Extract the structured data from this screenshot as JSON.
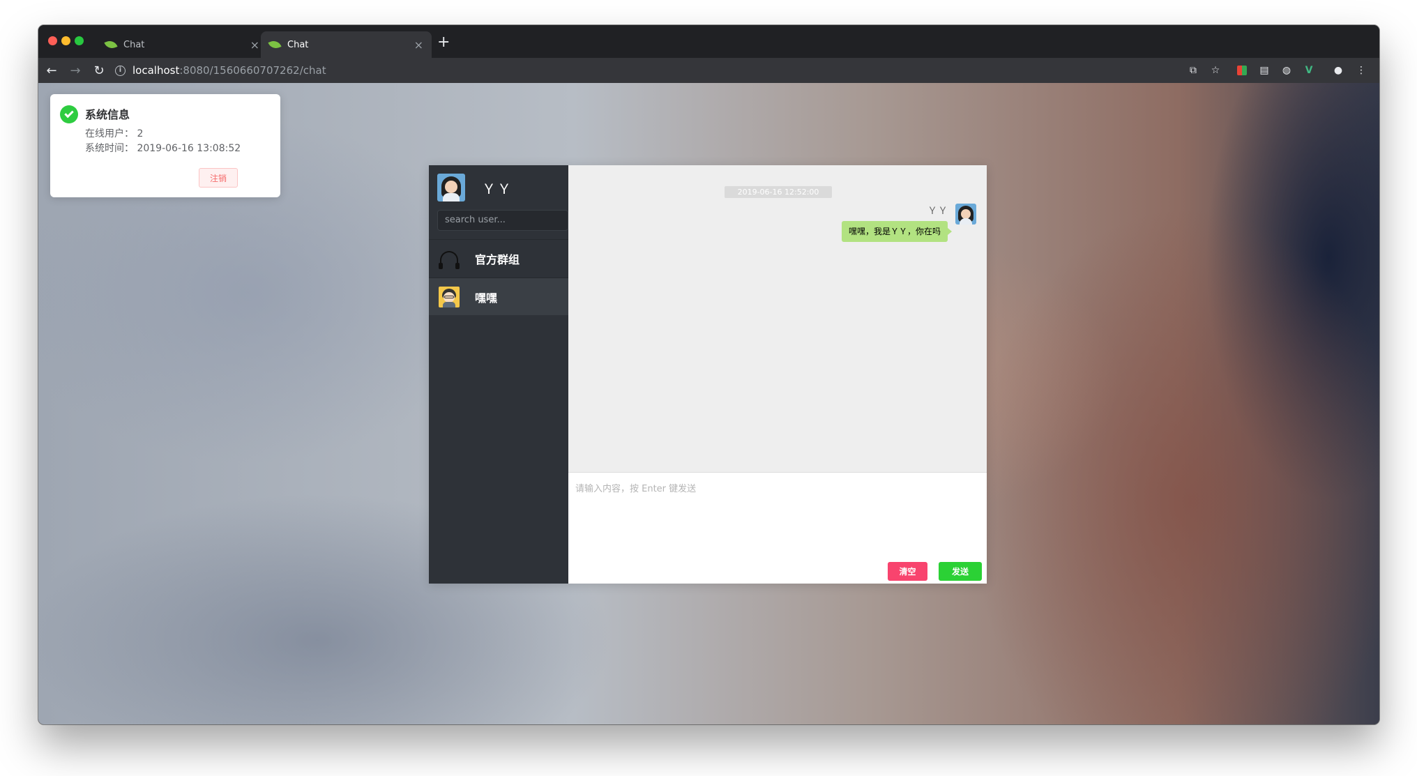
{
  "browser": {
    "tabs": [
      {
        "title": "Chat",
        "active": false
      },
      {
        "title": "Chat",
        "active": true
      }
    ],
    "url_host": "localhost",
    "url_path": ":8080/1560660707262/chat",
    "new_tab_symbol": "+"
  },
  "notification": {
    "title": "系统信息",
    "online_users": "在线用户： 2",
    "system_time": "系统时间： 2019-06-16 13:08:52",
    "logout_label": "注销"
  },
  "sidebar": {
    "me_name": "ＹＹ",
    "search_placeholder": "search user...",
    "contacts": [
      {
        "name": "官方群组",
        "icon": "headset-icon"
      },
      {
        "name": "嘿嘿",
        "icon": "avatar-icon",
        "selected": true
      }
    ]
  },
  "chat": {
    "timestamp": "2019-06-16 12:52:00",
    "messages": [
      {
        "sender": "ＹＹ",
        "text": "嘿嘿，我是ＹＹ，你在吗"
      }
    ],
    "input_placeholder": "请输入内容，按 Enter 键发送",
    "clear_label": "清空",
    "send_label": "发送"
  },
  "colors": {
    "sidebar_bg": "#2e3238",
    "bubble_bg": "#b2e281",
    "clear_button": "#f8446e",
    "send_button": "#2bd135",
    "success": "#2ecc40"
  }
}
